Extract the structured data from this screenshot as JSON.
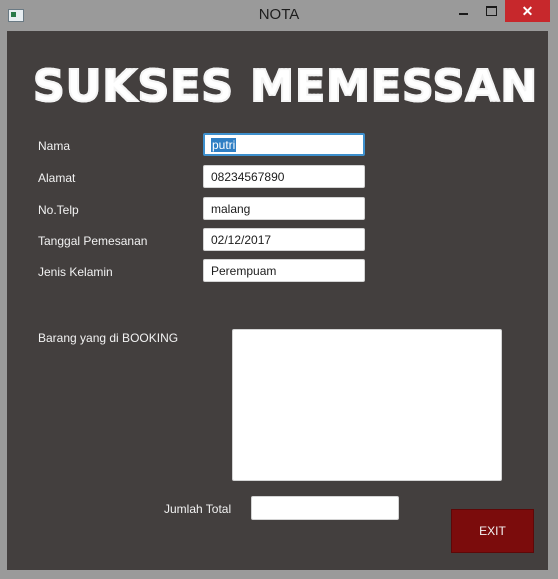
{
  "window": {
    "title": "NOTA",
    "close_glyph": "✕"
  },
  "heading": "SUKSES MEMESSAN",
  "form": {
    "nama_label": "Nama",
    "nama_value": "putri",
    "alamat_label": "Alamat",
    "alamat_value": "08234567890",
    "telp_label": "No.Telp",
    "telp_value": "malang",
    "tanggal_label": "Tanggal Pemesanan",
    "tanggal_value": "02/12/2017",
    "kelamin_label": "Jenis Kelamin",
    "kelamin_value": "Perempuam",
    "barang_label": "Barang yang di BOOKING",
    "barang_value": "",
    "total_label": "Jumlah Total",
    "total_value": ""
  },
  "buttons": {
    "exit_label": "EXIT"
  },
  "colors": {
    "panel_bg": "#433f3e",
    "exit_bg": "#7b0c0c",
    "focus_border": "#3d8fcc",
    "close_bg": "#c7282c"
  },
  "icons": {
    "app": "window-app-icon",
    "minimize": "minimize-icon",
    "maximize": "maximize-icon",
    "close": "close-icon"
  }
}
